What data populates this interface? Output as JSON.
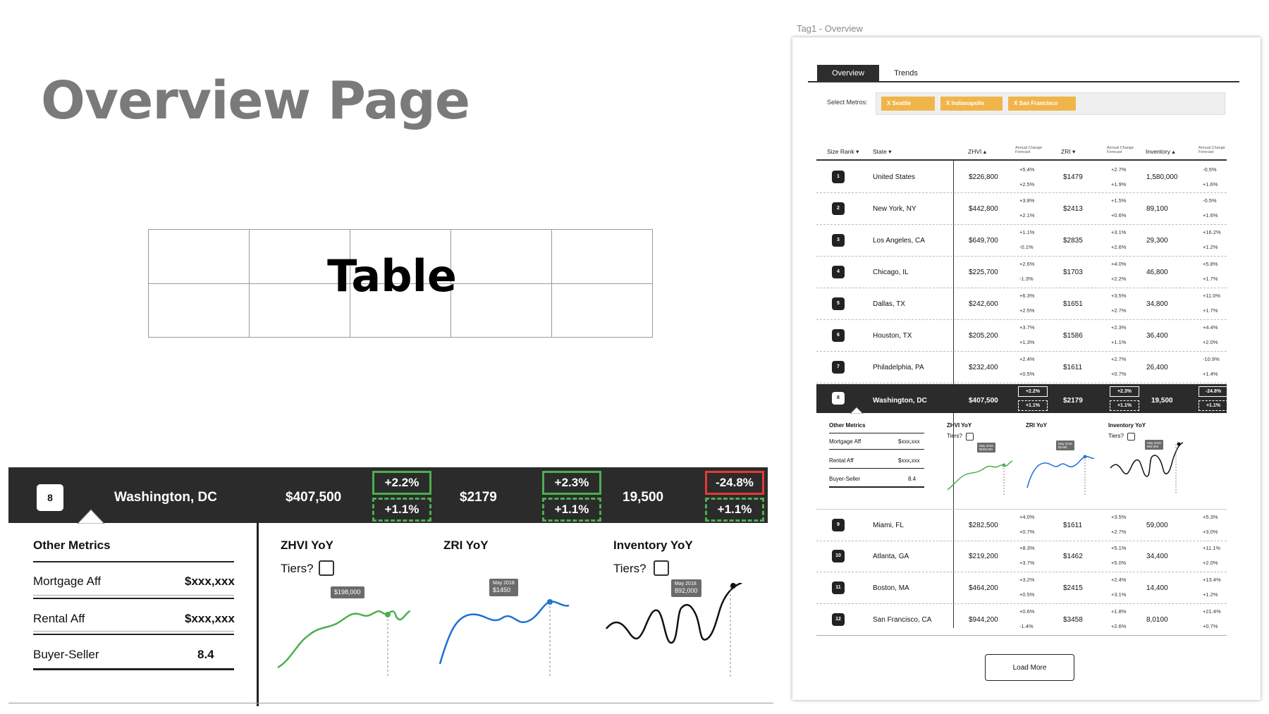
{
  "page_title": "Overview Page",
  "table_placeholder_label": "Table",
  "big_row": {
    "rank": "8",
    "name": "Washington, DC",
    "zhvi": "$407,500",
    "zhvi_change": "+2.2%",
    "zhvi_forecast": "+1.1%",
    "zri": "$2179",
    "zri_change": "+2.3%",
    "zri_forecast": "+1.1%",
    "inventory": "19,500",
    "inventory_change": "-24.8%",
    "inventory_forecast": "+1.1%"
  },
  "detail": {
    "other_metrics_title": "Other Metrics",
    "metrics": [
      {
        "label": "Mortgage Aff",
        "value": "$xxx,xxx"
      },
      {
        "label": "Rental Aff",
        "value": "$xxx,xxx"
      },
      {
        "label": "Buyer-Seller",
        "value": "8.4"
      }
    ],
    "zhvi_yoy": "ZHVI YoY",
    "zri_yoy": "ZRI YoY",
    "inventory_yoy": "Inventory YoY",
    "tiers_label": "Tiers?",
    "zhvi_tooltip": "$198,000",
    "zri_tooltip_date": "May 2018",
    "zri_tooltip_value": "$1450",
    "inv_tooltip_date": "May 2018",
    "inv_tooltip_value": "892,000",
    "colors": {
      "zhvi": "#4caf50",
      "zri": "#1e6fd9",
      "inventory": "#111111",
      "up": "#4caf50",
      "down": "#e53935"
    }
  },
  "right_panel": {
    "frame_title": "Tag1 - Overview",
    "tabs": [
      "Overview",
      "Trends"
    ],
    "select_metros_label": "Select Metros:",
    "metro_chips": [
      "X  Seattle",
      "X  Indianapolis",
      "X  San Francisco"
    ],
    "headers": {
      "size_rank": "Size Rank ▾",
      "state": "State ▾",
      "zhvi": "ZHVI ▴",
      "annual_change": "Annual Change",
      "forecast": "Forecast",
      "zri": "ZRI ▾",
      "inventory": "Inventory ▴"
    },
    "rows": [
      {
        "rank": "1",
        "name": "United States",
        "zhvi": "$226,800",
        "zc": "+5.4%",
        "zf": "+2.5%",
        "zri": "$1479",
        "rc": "+2.7%",
        "rf": "+1.9%",
        "inv": "1,580,000",
        "ic": "-0.5%",
        "if": "+1.6%"
      },
      {
        "rank": "2",
        "name": "New York, NY",
        "zhvi": "$442,800",
        "zc": "+3.8%",
        "zf": "+2.1%",
        "zri": "$2413",
        "rc": "+1.5%",
        "rf": "+0.6%",
        "inv": "89,100",
        "ic": "-0.5%",
        "if": "+1.6%"
      },
      {
        "rank": "3",
        "name": "Los Angeles, CA",
        "zhvi": "$649,700",
        "zc": "+1.1%",
        "zf": "-0.1%",
        "zri": "$2835",
        "rc": "+3.1%",
        "rf": "+2.6%",
        "inv": "29,300",
        "ic": "+16.2%",
        "if": "+1.2%"
      },
      {
        "rank": "4",
        "name": "Chicago, IL",
        "zhvi": "$225,700",
        "zc": "+2.6%",
        "zf": "-1.3%",
        "zri": "$1703",
        "rc": "+4.0%",
        "rf": "+2.2%",
        "inv": "46,800",
        "ic": "+5.8%",
        "if": "+1.7%"
      },
      {
        "rank": "5",
        "name": "Dallas, TX",
        "zhvi": "$242,600",
        "zc": "+6.3%",
        "zf": "+2.5%",
        "zri": "$1651",
        "rc": "+3.5%",
        "rf": "+2.7%",
        "inv": "34,800",
        "ic": "+11.0%",
        "if": "+1.7%"
      },
      {
        "rank": "6",
        "name": "Houston, TX",
        "zhvi": "$205,200",
        "zc": "+3.7%",
        "zf": "+1.3%",
        "zri": "$1586",
        "rc": "+2.3%",
        "rf": "+1.1%",
        "inv": "36,400",
        "ic": "+4.4%",
        "if": "+2.0%"
      },
      {
        "rank": "7",
        "name": "Philadelphia, PA",
        "zhvi": "$232,400",
        "zc": "+2.4%",
        "zf": "+0.5%",
        "zri": "$1611",
        "rc": "+2.7%",
        "rf": "+0.7%",
        "inv": "26,400",
        "ic": "-10.9%",
        "if": "+1.4%"
      },
      {
        "rank": "8",
        "name": "Washington, DC",
        "zhvi": "$407,500",
        "zc": "+2.2%",
        "zf": "+1.1%",
        "zri": "$2179",
        "rc": "+2.3%",
        "rf": "+1.1%",
        "inv": "19,500",
        "ic": "-24.8%",
        "if": "+1.1%"
      },
      {
        "rank": "9",
        "name": "Miami, FL",
        "zhvi": "$282,500",
        "zc": "+4.0%",
        "zf": "+0.7%",
        "zri": "$1611",
        "rc": "+3.5%",
        "rf": "+2.7%",
        "inv": "59,000",
        "ic": "+5.3%",
        "if": "+3.0%"
      },
      {
        "rank": "10",
        "name": "Atlanta, GA",
        "zhvi": "$219,200",
        "zc": "+8.3%",
        "zf": "+3.7%",
        "zri": "$1462",
        "rc": "+5.1%",
        "rf": "+5.0%",
        "inv": "34,400",
        "ic": "+11.1%",
        "if": "+2.0%"
      },
      {
        "rank": "11",
        "name": "Boston, MA",
        "zhvi": "$464,200",
        "zc": "+3.2%",
        "zf": "+0.5%",
        "zri": "$2415",
        "rc": "+2.4%",
        "rf": "+3.1%",
        "inv": "14,400",
        "ic": "+13.4%",
        "if": "+1.2%"
      },
      {
        "rank": "12",
        "name": "San Francisco, CA",
        "zhvi": "$944,200",
        "zc": "+0.6%",
        "zf": "-1.4%",
        "zri": "$3458",
        "rc": "+1.8%",
        "rf": "+2.6%",
        "inv": "8,0100",
        "ic": "+21.4%",
        "if": "+0.7%"
      }
    ],
    "mini_detail": {
      "title": "Other Metrics",
      "metrics": [
        {
          "label": "Mortgage Aff",
          "value": "$xxx,xxx"
        },
        {
          "label": "Rental Aff",
          "value": "$xxx,xxx"
        },
        {
          "label": "Buyer-Seller",
          "value": "8.4"
        }
      ],
      "zhvi_yoy": "ZHVI YoY",
      "zri_yoy": "ZRI YoY",
      "inventory_yoy": "Inventory YoY",
      "tiers_label": "Tiers?",
      "zhvi_tip_date": "May 2018",
      "zhvi_tip_value": "$198,000",
      "zri_tip_date": "May 2018",
      "zri_tip_value": "$1450",
      "inv_tip_date": "May 2018",
      "inv_tip_value": "892,000"
    },
    "load_more": "Load More"
  }
}
